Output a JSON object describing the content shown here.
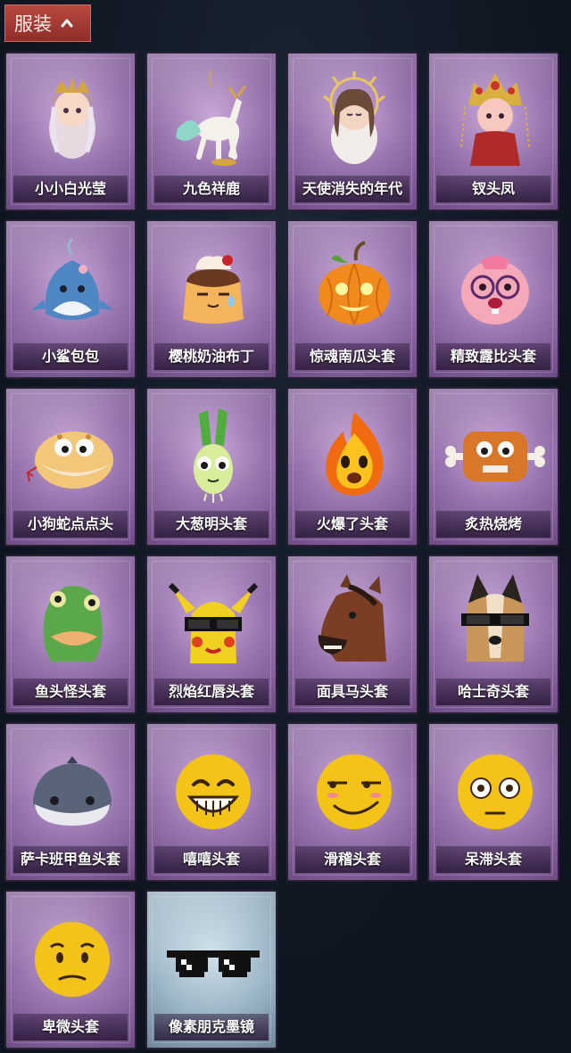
{
  "section": {
    "title": "服装"
  },
  "items": [
    {
      "name": "小小白光莹",
      "icon": "chibi-goddess-icon"
    },
    {
      "name": "九色祥鹿",
      "icon": "white-deer-icon"
    },
    {
      "name": "天使消失的年代",
      "icon": "angel-girl-icon"
    },
    {
      "name": "钗头凤",
      "icon": "phoenix-crown-girl-icon"
    },
    {
      "name": "小鲨包包",
      "icon": "shark-bag-icon"
    },
    {
      "name": "樱桃奶油布丁",
      "icon": "pudding-icon"
    },
    {
      "name": "惊魂南瓜头套",
      "icon": "pumpkin-icon"
    },
    {
      "name": "精致露比头套",
      "icon": "pink-beaver-icon"
    },
    {
      "name": "小狗蛇点点头",
      "icon": "snake-head-icon"
    },
    {
      "name": "大葱明头套",
      "icon": "green-onion-icon"
    },
    {
      "name": "火爆了头套",
      "icon": "fire-spirit-icon"
    },
    {
      "name": "炙热烧烤",
      "icon": "meat-bone-icon"
    },
    {
      "name": "鱼头怪头套",
      "icon": "fish-head-icon"
    },
    {
      "name": "烈焰红唇头套",
      "icon": "yellow-mouse-icon"
    },
    {
      "name": "面具马头套",
      "icon": "horse-head-icon"
    },
    {
      "name": "哈士奇头套",
      "icon": "husky-head-icon"
    },
    {
      "name": "萨卡班甲鱼头套",
      "icon": "ancient-fish-icon"
    },
    {
      "name": "嘻嘻头套",
      "icon": "grin-emoji-icon"
    },
    {
      "name": "滑稽头套",
      "icon": "smirk-emoji-icon"
    },
    {
      "name": "呆滞头套",
      "icon": "flushed-emoji-icon"
    },
    {
      "name": "卑微头套",
      "icon": "pleading-emoji-icon"
    },
    {
      "name": "像素朋克墨镜",
      "icon": "pixel-sunglasses-icon",
      "rarity": "blue"
    }
  ]
}
